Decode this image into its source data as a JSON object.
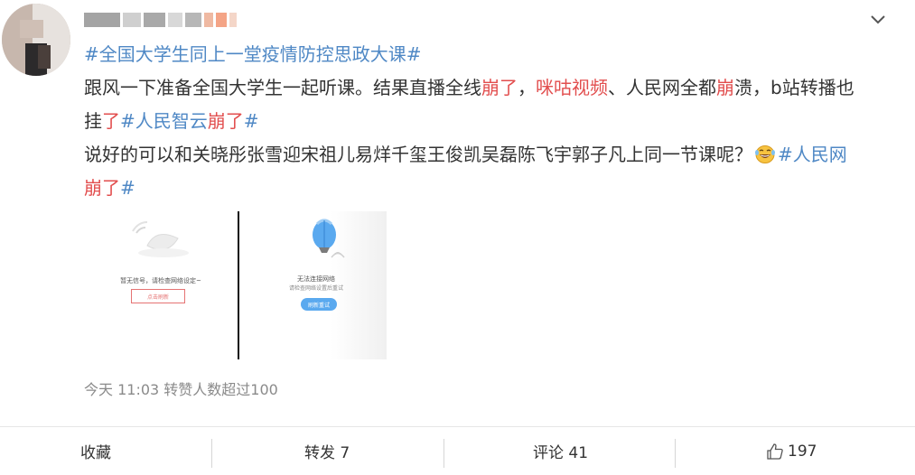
{
  "post": {
    "hashtag_title": "#全国大学生同上一堂疫情防控思政大课#",
    "line2": {
      "a": "跟风一下准备全国大学生一起听课。结果直播全线",
      "b": "崩了",
      "c": "，",
      "d": "咪咕视频",
      "e": "、人民网全都",
      "f": "崩",
      "g": "溃，b站转播也"
    },
    "line3": {
      "a": "挂",
      "b": "了",
      "c": "#人民智云",
      "d": "崩了",
      "e": "#"
    },
    "line4": {
      "a": "说好的可以和关晓彤张雪迎宋祖儿易烊千玺王俊凯吴磊陈飞宇郭子凡上同一节课呢？",
      "emoji": "laughing-tears-emoji",
      "b": "#人民网"
    },
    "line5": {
      "a": "崩了",
      "b": "#"
    }
  },
  "images": {
    "left": {
      "text": "暂无信号，请检查网络设定~",
      "button": "点击刷新"
    },
    "right": {
      "text": "无法连接网络",
      "subtext": "请检查网络设置后重试",
      "button": "刷新重试"
    }
  },
  "meta": {
    "time": "今天 11:03",
    "repost_note": "转赞人数超过100"
  },
  "actions": {
    "favorite": "收藏",
    "repost": "转发 7",
    "comment": "评论 41",
    "like_count": "197"
  },
  "colors": {
    "tag": "#4f88c5",
    "red": "#e24e4e",
    "meta": "#8a8a8a"
  }
}
